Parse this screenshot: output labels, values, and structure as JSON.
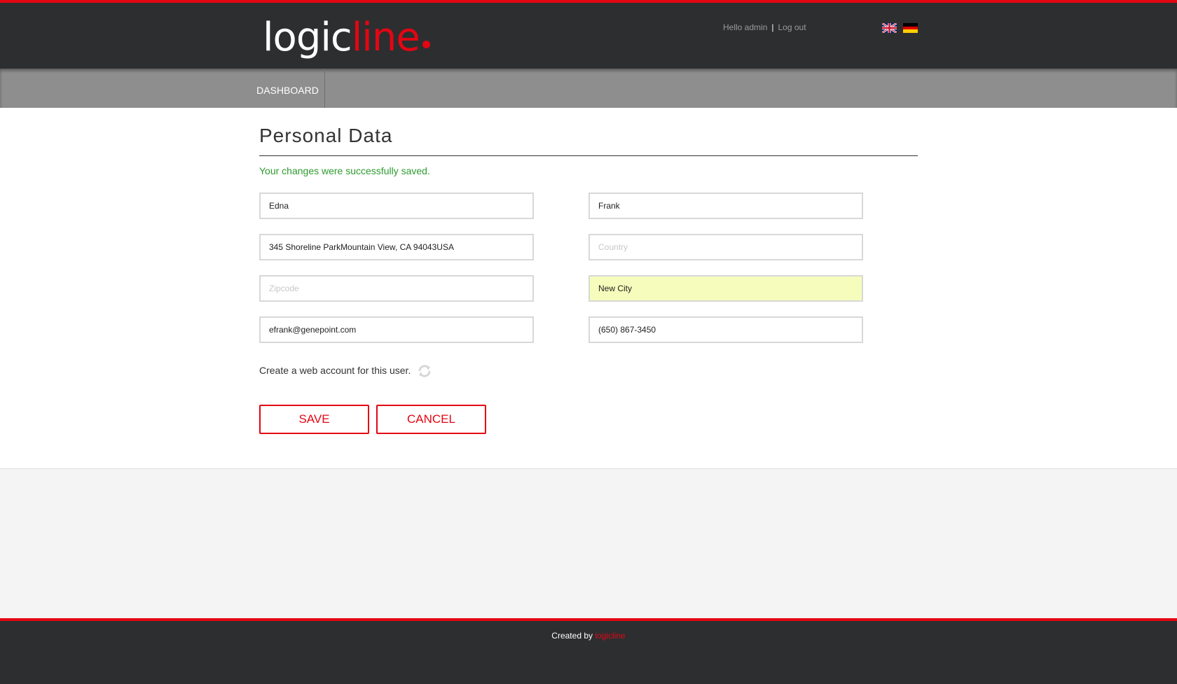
{
  "header": {
    "logo_primary": "logic",
    "logo_accent": "line",
    "greeting": "Hello admin",
    "separator": "|",
    "logout": "Log out",
    "flags": [
      "uk-flag-icon",
      "german-flag-icon"
    ]
  },
  "nav": {
    "items": [
      {
        "label": "DASHBOARD"
      }
    ]
  },
  "page": {
    "title": "Personal Data",
    "success_message": "Your changes were successfully saved."
  },
  "form": {
    "first_name": {
      "value": "Edna",
      "placeholder": ""
    },
    "last_name": {
      "value": "Frank",
      "placeholder": ""
    },
    "street": {
      "value": "345 Shoreline ParkMountain View, CA 94043USA",
      "placeholder": ""
    },
    "country": {
      "value": "",
      "placeholder": "Country"
    },
    "zipcode": {
      "value": "",
      "placeholder": "Zipcode"
    },
    "city": {
      "value": "New City",
      "placeholder": ""
    },
    "email": {
      "value": "efrank@genepoint.com",
      "placeholder": ""
    },
    "phone": {
      "value": "(650) 867-3450",
      "placeholder": ""
    },
    "web_account_label": "Create a web account for this user.",
    "save_label": "SAVE",
    "cancel_label": "CANCEL"
  },
  "footer": {
    "created_by": "Created by",
    "brand": "logicline"
  },
  "colors": {
    "accent": "#e30613",
    "header_bg": "#2d2e30",
    "nav_bg": "#8e8e8e",
    "success": "#2e9b2e",
    "highlight_field": "#f6fcbc"
  }
}
